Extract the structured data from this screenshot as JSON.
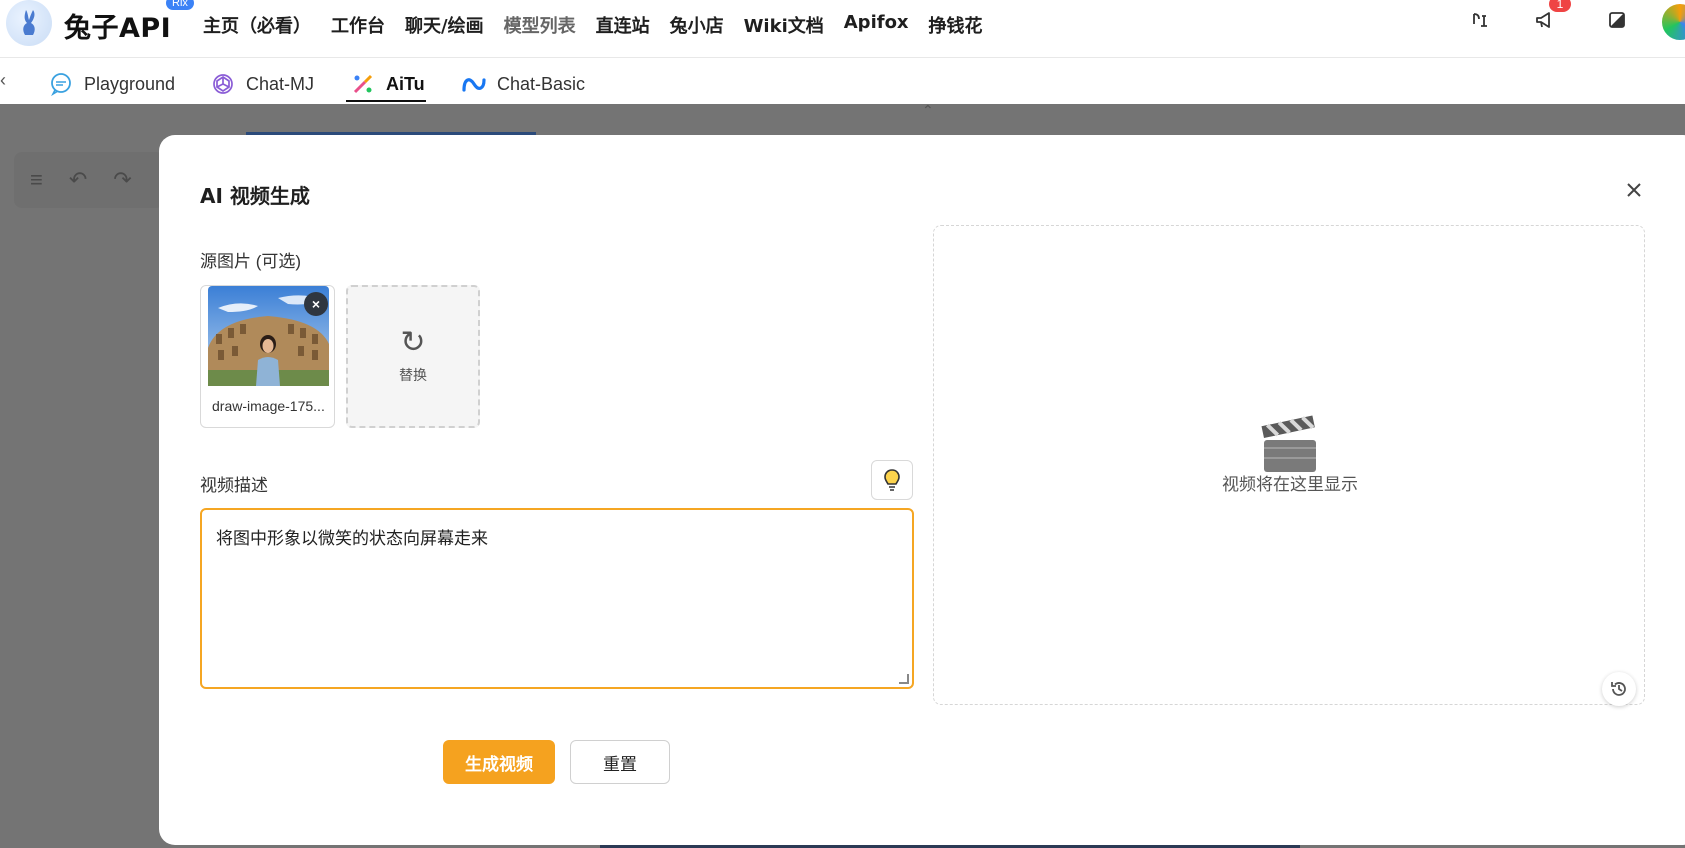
{
  "app": {
    "brand": "兔子API",
    "brand_badge": "Rix"
  },
  "nav": {
    "items": [
      {
        "label": "主页（必看）",
        "muted": false
      },
      {
        "label": "工作台",
        "muted": false
      },
      {
        "label": "聊天/绘画",
        "muted": false
      },
      {
        "label": "模型列表",
        "muted": true
      },
      {
        "label": "直连站",
        "muted": false
      },
      {
        "label": "兔小店",
        "muted": false
      },
      {
        "label": "Wiki文档",
        "muted": false
      },
      {
        "label": "Apifox",
        "muted": false
      },
      {
        "label": "挣钱花",
        "muted": false
      }
    ],
    "notification_count": "1",
    "icons": [
      "translate-icon",
      "announcement-icon",
      "theme-icon",
      "avatar"
    ]
  },
  "tabs": [
    {
      "label": "Playground",
      "icon": "chat-bubble-icon",
      "active": false
    },
    {
      "label": "Chat-MJ",
      "icon": "openai-icon",
      "active": false
    },
    {
      "label": "AiTu",
      "icon": "paint-brush-icon",
      "active": true
    },
    {
      "label": "Chat-Basic",
      "icon": "meta-icon",
      "active": false
    }
  ],
  "modal": {
    "title": "AI 视频生成",
    "source_image_label": "源图片 (可选)",
    "source_image_name": "draw-image-175...",
    "replace_label": "替换",
    "description_label": "视频描述",
    "description_value": "将图中形象以微笑的状态向屏幕走来",
    "generate_button": "生成视频",
    "reset_button": "重置",
    "preview_placeholder": "视频将在这里显示"
  },
  "colors": {
    "accent": "#f5a21f",
    "overlay": "#747474",
    "badge": "#ef4444"
  }
}
